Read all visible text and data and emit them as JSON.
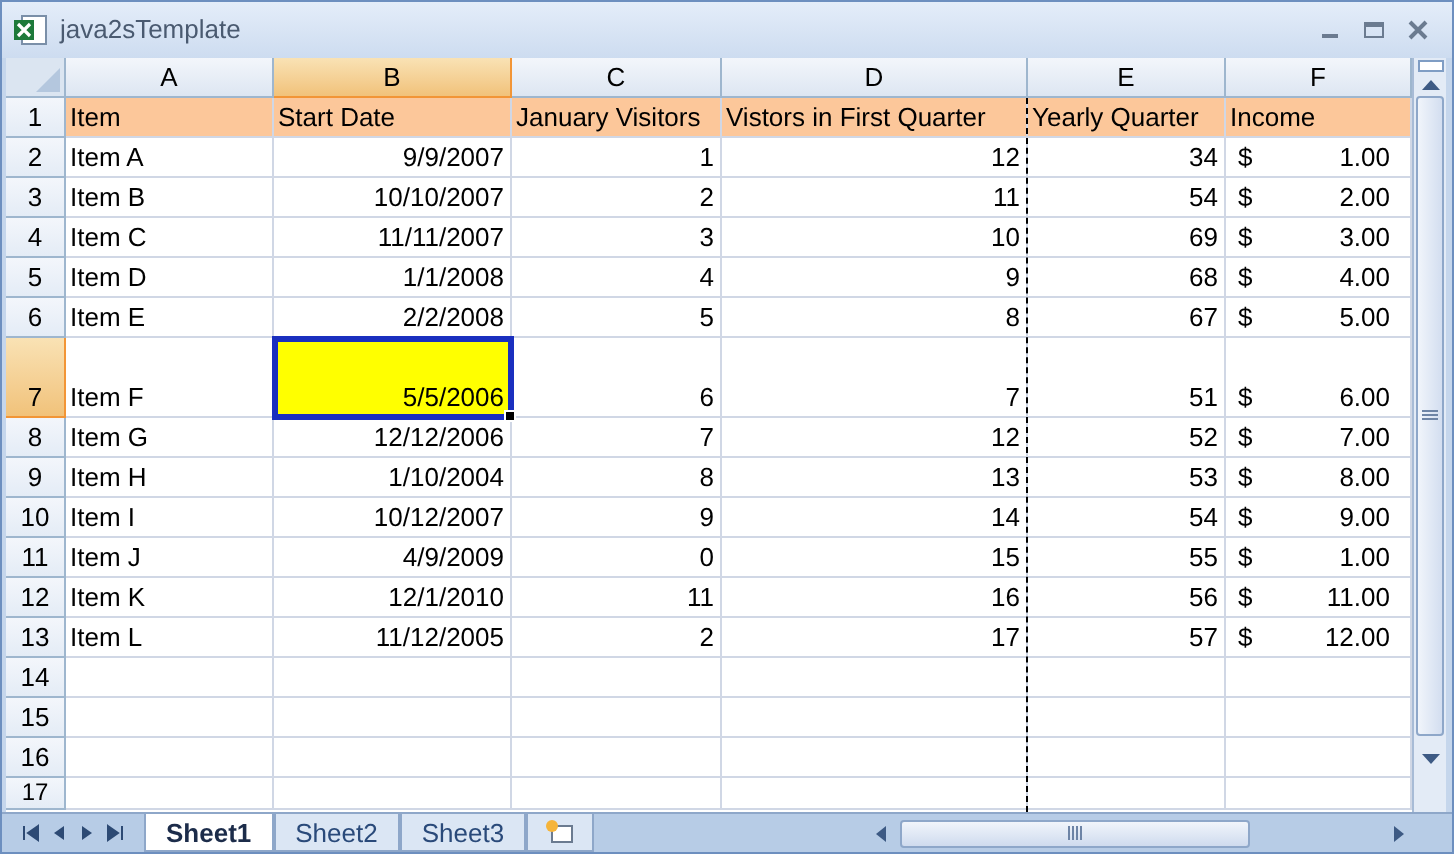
{
  "window": {
    "title": "java2sTemplate"
  },
  "columns": [
    {
      "label": "A",
      "selected": false
    },
    {
      "label": "B",
      "selected": true
    },
    {
      "label": "C",
      "selected": false
    },
    {
      "label": "D",
      "selected": false
    },
    {
      "label": "E",
      "selected": false
    },
    {
      "label": "F",
      "selected": false
    }
  ],
  "rows": [
    {
      "number": "1",
      "selected": false,
      "kind": "header",
      "cells": [
        "Item",
        "Start Date",
        "January Visitors",
        "Vistors in First Quarter",
        "Yearly Quarter",
        "Income"
      ]
    },
    {
      "number": "2",
      "selected": false,
      "kind": "data",
      "cells": [
        "Item A",
        "9/9/2007",
        "1",
        "12",
        "34"
      ],
      "income": {
        "symbol": "$",
        "amount": "1.00"
      }
    },
    {
      "number": "3",
      "selected": false,
      "kind": "data",
      "cells": [
        "Item B",
        "10/10/2007",
        "2",
        "11",
        "54"
      ],
      "income": {
        "symbol": "$",
        "amount": "2.00"
      }
    },
    {
      "number": "4",
      "selected": false,
      "kind": "data",
      "cells": [
        "Item C",
        "11/11/2007",
        "3",
        "10",
        "69"
      ],
      "income": {
        "symbol": "$",
        "amount": "3.00"
      }
    },
    {
      "number": "5",
      "selected": false,
      "kind": "data",
      "cells": [
        "Item D",
        "1/1/2008",
        "4",
        "9",
        "68"
      ],
      "income": {
        "symbol": "$",
        "amount": "4.00"
      }
    },
    {
      "number": "6",
      "selected": false,
      "kind": "data",
      "cells": [
        "Item E",
        "2/2/2008",
        "5",
        "8",
        "67"
      ],
      "income": {
        "symbol": "$",
        "amount": "5.00"
      }
    },
    {
      "number": "7",
      "selected": true,
      "kind": "data",
      "cells": [
        "Item F",
        "5/5/2006",
        "6",
        "7",
        "51"
      ],
      "income": {
        "symbol": "$",
        "amount": "6.00"
      }
    },
    {
      "number": "8",
      "selected": false,
      "kind": "data",
      "cells": [
        "Item G",
        "12/12/2006",
        "7",
        "12",
        "52"
      ],
      "income": {
        "symbol": "$",
        "amount": "7.00"
      }
    },
    {
      "number": "9",
      "selected": false,
      "kind": "data",
      "cells": [
        "Item H",
        "1/10/2004",
        "8",
        "13",
        "53"
      ],
      "income": {
        "symbol": "$",
        "amount": "8.00"
      }
    },
    {
      "number": "10",
      "selected": false,
      "kind": "data",
      "cells": [
        "Item I",
        "10/12/2007",
        "9",
        "14",
        "54"
      ],
      "income": {
        "symbol": "$",
        "amount": "9.00"
      }
    },
    {
      "number": "11",
      "selected": false,
      "kind": "data",
      "cells": [
        "Item J",
        "4/9/2009",
        "0",
        "15",
        "55"
      ],
      "income": {
        "symbol": "$",
        "amount": "1.00"
      }
    },
    {
      "number": "12",
      "selected": false,
      "kind": "data",
      "cells": [
        "Item K",
        "12/1/2010",
        "11",
        "16",
        "56"
      ],
      "income": {
        "symbol": "$",
        "amount": "11.00"
      }
    },
    {
      "number": "13",
      "selected": false,
      "kind": "data",
      "cells": [
        "Item L",
        "11/12/2005",
        "2",
        "17",
        "57"
      ],
      "income": {
        "symbol": "$",
        "amount": "12.00"
      }
    },
    {
      "number": "14",
      "selected": false,
      "kind": "empty"
    },
    {
      "number": "15",
      "selected": false,
      "kind": "empty"
    },
    {
      "number": "16",
      "selected": false,
      "kind": "empty"
    },
    {
      "number": "17",
      "selected": false,
      "kind": "empty"
    }
  ],
  "sheet_tabs": [
    {
      "label": "Sheet1",
      "selected": true
    },
    {
      "label": "Sheet2",
      "selected": false
    },
    {
      "label": "Sheet3",
      "selected": false
    }
  ]
}
